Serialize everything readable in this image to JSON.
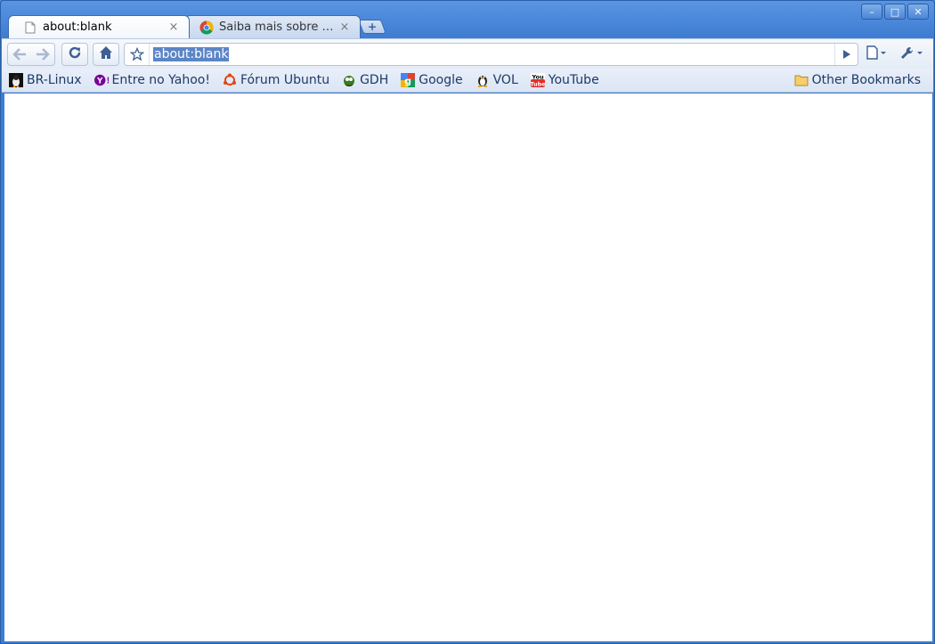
{
  "tabs": [
    {
      "title": "about:blank",
      "icon": "page-icon",
      "active": true
    },
    {
      "title": "Saiba mais sobre o Google Chrome",
      "icon": "chrome-icon",
      "active": false
    }
  ],
  "tab_close_glyph": "×",
  "new_tab_glyph": "+",
  "window_controls": {
    "minimize": "–",
    "maximize": "□",
    "close": "✕"
  },
  "omnibox": {
    "url": "about:blank"
  },
  "bookmarks": [
    {
      "label": "BR-Linux",
      "icon": "tux-icon"
    },
    {
      "label": "Entre no Yahoo!",
      "icon": "yahoo-icon"
    },
    {
      "label": "Fórum Ubuntu",
      "icon": "ubuntu-icon"
    },
    {
      "label": "GDH",
      "icon": "gdh-icon"
    },
    {
      "label": "Google",
      "icon": "google-icon"
    },
    {
      "label": "VOL",
      "icon": "tux-icon"
    },
    {
      "label": "YouTube",
      "icon": "youtube-icon"
    }
  ],
  "other_bookmarks": "Other Bookmarks",
  "colors": {
    "titlebar": "#4a86d9",
    "selection": "#5b85c7",
    "bookmark_text": "#1d3a66"
  }
}
